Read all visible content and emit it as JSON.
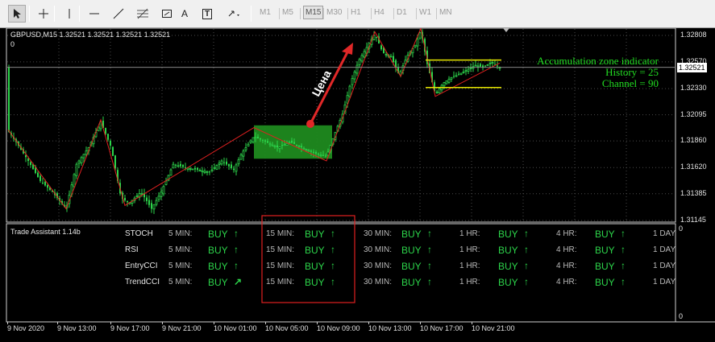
{
  "toolbar": {
    "tools": [
      {
        "name": "cursor-tool-button",
        "icon": "cursor-arrow-icon",
        "pressed": true
      },
      {
        "name": "crosshair-tool-button",
        "icon": "crosshair-icon",
        "pressed": false
      },
      {
        "name": "vertical-line-tool-button",
        "icon": "vertical-line-icon",
        "pressed": false
      },
      {
        "name": "horizontal-line-tool-button",
        "icon": "horizontal-line-icon",
        "pressed": false
      },
      {
        "name": "trendline-tool-button",
        "icon": "trendline-icon",
        "pressed": false
      },
      {
        "name": "fibonacci-tool-button",
        "icon": "fibonacci-icon",
        "pressed": false
      },
      {
        "name": "rectangle-tool-button",
        "icon": "rectangle-icon",
        "pressed": false
      },
      {
        "name": "text-tool-button",
        "label": "A",
        "pressed": false
      },
      {
        "name": "text-label-tool-button",
        "label": "T",
        "pressed": false
      },
      {
        "name": "arrows-tool-button",
        "icon": "arrows-dropdown-icon",
        "pressed": false
      }
    ],
    "timeframes": [
      "M1",
      "M5",
      "M15",
      "M30",
      "H1",
      "H4",
      "D1",
      "W1",
      "MN"
    ],
    "selected_timeframe": "M15"
  },
  "chart": {
    "header": "GBPUSD,M15  1.32521 1.32521 1.32521 1.32521",
    "subwindow_zero": "0",
    "price_labels": [
      "1.32808",
      "1.32570",
      "1.32521",
      "1.32330",
      "1.32095",
      "1.31860",
      "1.31620",
      "1.31385",
      "1.31145"
    ],
    "current_price": "1.32521",
    "annotation_text": "Цена",
    "indicator": {
      "title": "Accumulation zone indicator",
      "history": "History = 25",
      "channel": "Channel = 90"
    },
    "colors": {
      "candle": "#2cd44a",
      "zigzag": "#e02020",
      "zone": "#1f8a1f",
      "channel_lines": "#e6e600",
      "highlight_box": "#e02020",
      "text_indicator": "#22dd22"
    }
  },
  "trade_assistant": {
    "title": "Trade Assistant 1.14b",
    "panel_top": "0",
    "panel_bottom": "0",
    "indicators": [
      "STOCH",
      "RSI",
      "EntryCCI",
      "TrendCCI"
    ],
    "timeframes": [
      "5 MIN:",
      "15 MIN:",
      "30 MIN:",
      "1 HR:",
      "4 HR:",
      "1 DAY"
    ],
    "signal": "BUY",
    "arrows": [
      [
        "up",
        "up",
        "up",
        "up",
        "up"
      ],
      [
        "up",
        "up",
        "up",
        "up",
        "up"
      ],
      [
        "up",
        "up",
        "up",
        "up",
        "up"
      ],
      [
        "up-right",
        "up",
        "up",
        "up",
        "up"
      ]
    ]
  },
  "time_axis": [
    "9 Nov 2020",
    "9 Nov 13:00",
    "9 Nov 17:00",
    "9 Nov 21:00",
    "10 Nov 01:00",
    "10 Nov 05:00",
    "10 Nov 09:00",
    "10 Nov 13:00",
    "10 Nov 17:00",
    "10 Nov 21:00"
  ]
}
